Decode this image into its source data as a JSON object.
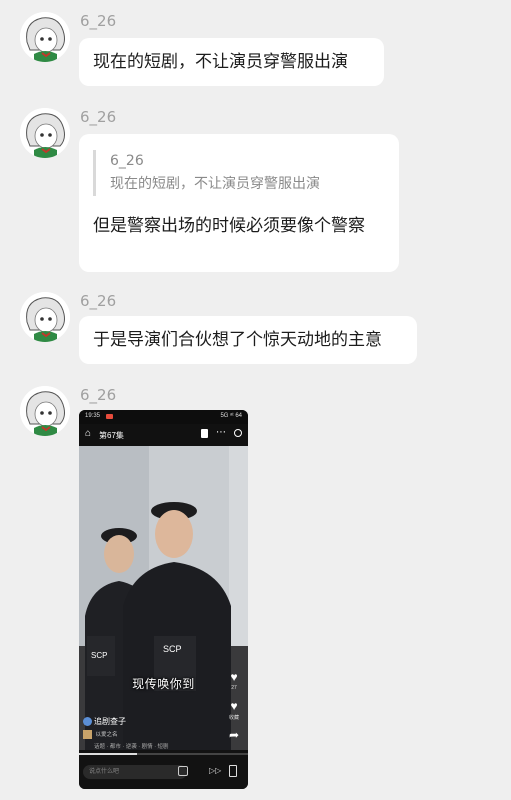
{
  "messages": [
    {
      "nickname": "6_26",
      "text": "现在的短剧，不让演员穿警服出演"
    },
    {
      "nickname": "6_26",
      "quote": {
        "nickname": "6_26",
        "text": "现在的短剧，不让演员穿警服出演"
      },
      "text": "但是警察出场的时候必须要像个警察"
    },
    {
      "nickname": "6_26",
      "text": "于是导演们合伙想了个惊天动地的主意"
    },
    {
      "nickname": "6_26"
    }
  ],
  "video": {
    "status_time": "19:35",
    "status_right": "5G ᵃᵗ 64",
    "home_icon": "home-icon",
    "episode": "第67集",
    "vest_label": "SCP",
    "subtitle": "现传唤你到",
    "like_count": "27",
    "fav_label": "收藏",
    "author": "追剧查子",
    "music": "以爱之名",
    "hashtags": "话题 · 都市 · 逆袭 · 剧情 · 短剧",
    "comment_placeholder": "说点什么吧"
  }
}
